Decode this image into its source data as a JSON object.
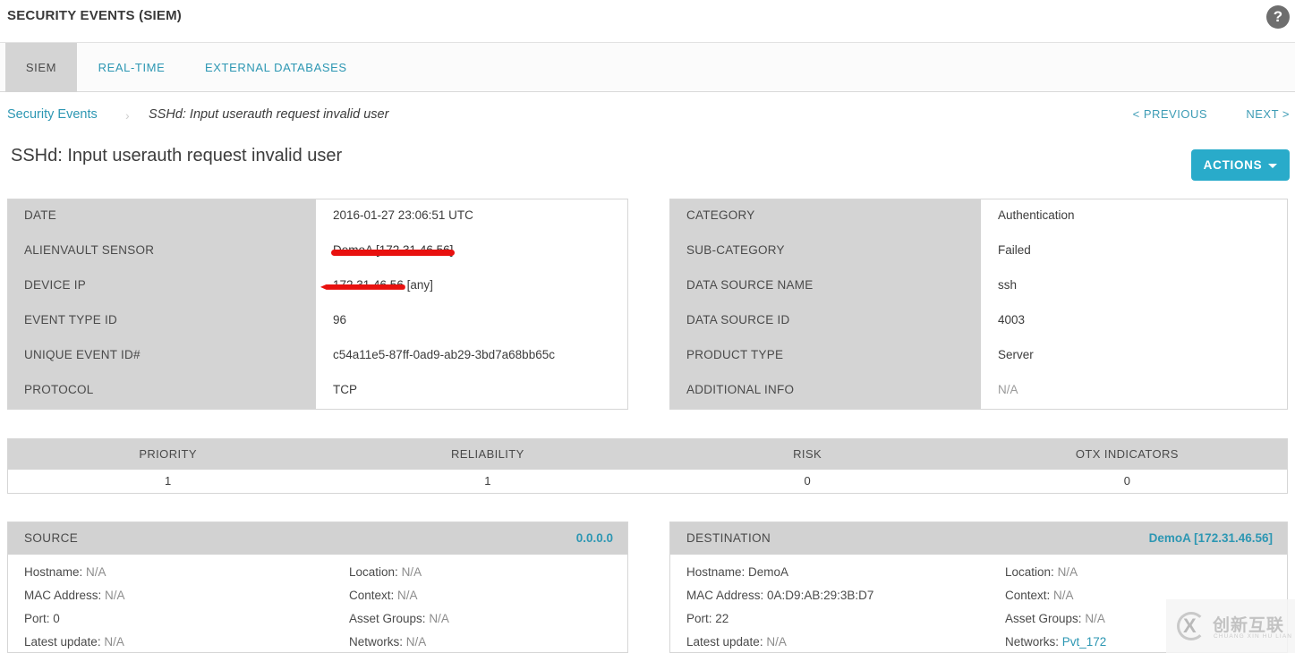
{
  "header": {
    "app_title": "SECURITY EVENTS (SIEM)",
    "help_icon": "question-mark-icon",
    "help_label": "?"
  },
  "tabs": [
    {
      "label": "SIEM",
      "active": true
    },
    {
      "label": "REAL-TIME",
      "active": false
    },
    {
      "label": "EXTERNAL DATABASES",
      "active": false
    }
  ],
  "breadcrumb": {
    "root": "Security Events",
    "separator": "›",
    "current": "SSHd: Input userauth request invalid user"
  },
  "pager": {
    "previous": "< PREVIOUS",
    "next": "NEXT >"
  },
  "page": {
    "title": "SSHd: Input userauth request invalid user"
  },
  "toolbar": {
    "actions_label": "ACTIONS",
    "actions_caret": "caret-down-icon"
  },
  "details_left": {
    "rows": [
      {
        "label": "DATE",
        "value": "2016-01-27 23:06:51 UTC",
        "redacted": false
      },
      {
        "label": "ALIENVAULT SENSOR",
        "value": "DemoA [172.31.46.56]",
        "redacted": true
      },
      {
        "label": "DEVICE IP",
        "value": "172.31.46.56",
        "suffix": " [any]",
        "redacted": true
      },
      {
        "label": "EVENT TYPE ID",
        "value": "96",
        "redacted": false
      },
      {
        "label": "UNIQUE EVENT ID#",
        "value": "c54a11e5-87ff-0ad9-ab29-3bd7a68bb65c",
        "redacted": false
      },
      {
        "label": "PROTOCOL",
        "value": "TCP",
        "redacted": false
      }
    ]
  },
  "details_right": {
    "rows": [
      {
        "label": "CATEGORY",
        "value": "Authentication",
        "muted": false
      },
      {
        "label": "SUB-CATEGORY",
        "value": "Failed",
        "muted": false
      },
      {
        "label": "DATA SOURCE NAME",
        "value": "ssh",
        "muted": false
      },
      {
        "label": "DATA SOURCE ID",
        "value": "4003",
        "muted": false
      },
      {
        "label": "PRODUCT TYPE",
        "value": "Server",
        "muted": false
      },
      {
        "label": "ADDITIONAL INFO",
        "value": "N/A",
        "muted": true
      }
    ]
  },
  "metrics": {
    "headers": [
      "PRIORITY",
      "RELIABILITY",
      "RISK",
      "OTX INDICATORS"
    ],
    "values": [
      "1",
      "1",
      "0",
      "0"
    ]
  },
  "source": {
    "title": "SOURCE",
    "address": "0.0.0.0",
    "left_items": [
      {
        "label": "Hostname:",
        "value": "N/A",
        "style": "muted"
      },
      {
        "label": "MAC Address:",
        "value": "N/A",
        "style": "muted"
      },
      {
        "label": "Port:",
        "value": "0",
        "style": "dark"
      },
      {
        "label": "Latest update:",
        "value": "N/A",
        "style": "muted"
      }
    ],
    "right_items": [
      {
        "label": "Location:",
        "value": "N/A",
        "style": "muted"
      },
      {
        "label": "Context:",
        "value": "N/A",
        "style": "muted"
      },
      {
        "label": "Asset Groups:",
        "value": "N/A",
        "style": "muted"
      },
      {
        "label": "Networks:",
        "value": "N/A",
        "style": "muted"
      }
    ]
  },
  "destination": {
    "title": "DESTINATION",
    "address": "DemoA [172.31.46.56]",
    "left_items": [
      {
        "label": "Hostname:",
        "value": "DemoA",
        "style": "dark"
      },
      {
        "label": "MAC Address:",
        "value": "0A:D9:AB:29:3B:D7",
        "style": "dark"
      },
      {
        "label": "Port:",
        "value": "22",
        "style": "dark"
      },
      {
        "label": "Latest update:",
        "value": "N/A",
        "style": "muted"
      }
    ],
    "right_items": [
      {
        "label": "Location:",
        "value": "N/A",
        "style": "muted"
      },
      {
        "label": "Context:",
        "value": "N/A",
        "style": "muted"
      },
      {
        "label": "Asset Groups:",
        "value": "N/A",
        "style": "muted"
      },
      {
        "label": "Networks:",
        "value": "Pvt_172",
        "style": "link"
      }
    ]
  },
  "watermark": {
    "mark": "X",
    "chinese": "创新互联",
    "pinyin": "CHUANG XIN HU LIAN"
  },
  "colors": {
    "accent_teal": "#2d97b3",
    "button_teal": "#29abca",
    "panel_gray": "#d4d4d4",
    "redaction_red": "#e8110f",
    "text_dark": "#3c3c3c",
    "text_muted": "#8d8d8d"
  }
}
